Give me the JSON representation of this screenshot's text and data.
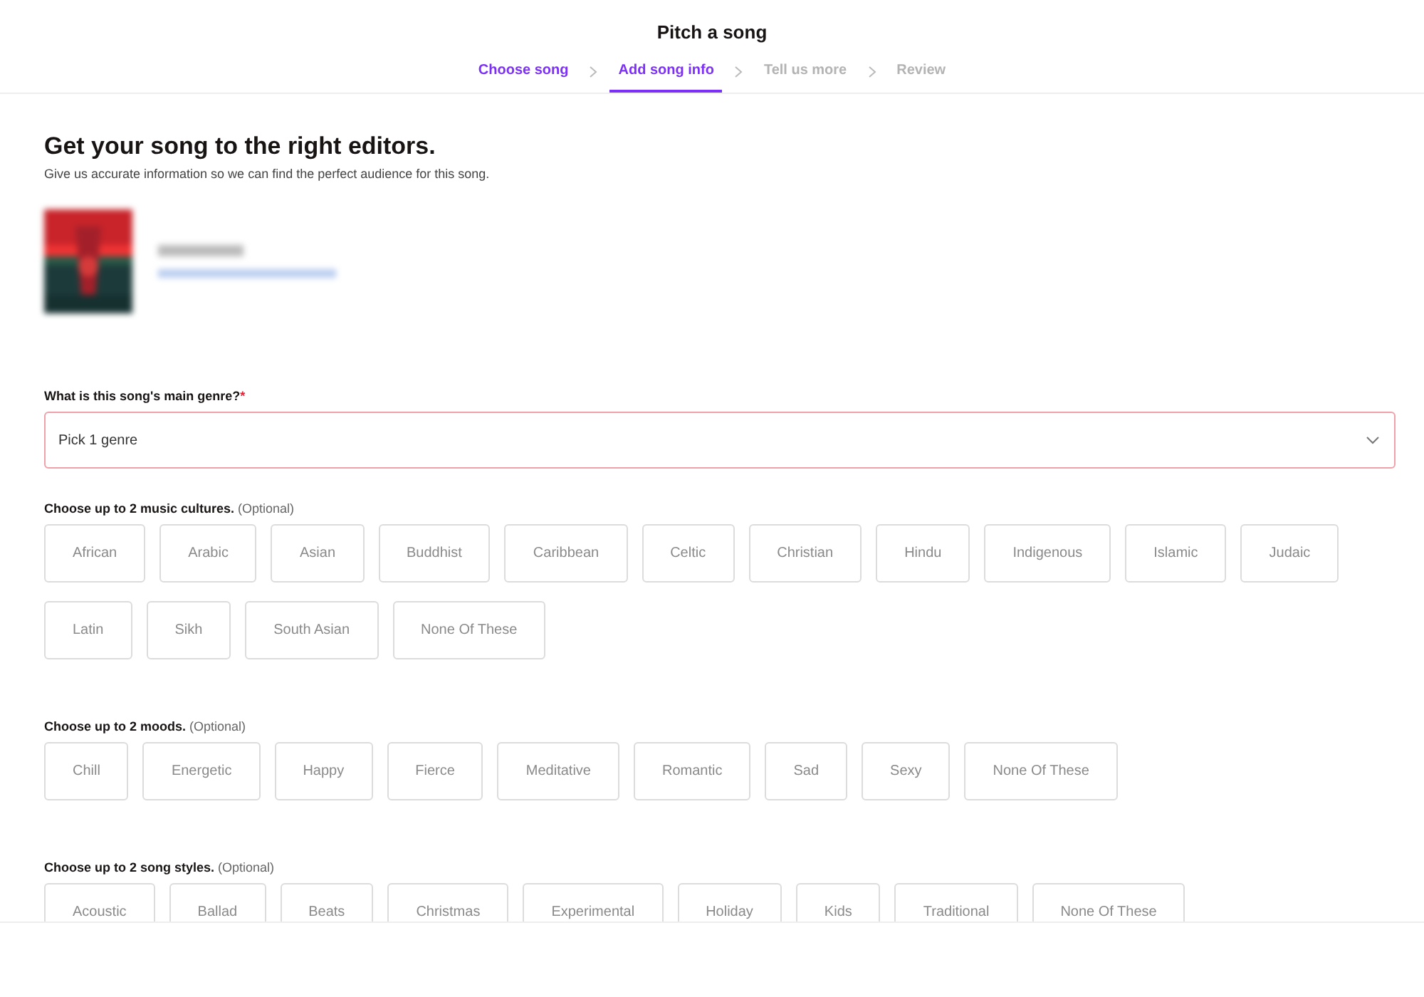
{
  "header": {
    "title": "Pitch a song",
    "steps": [
      {
        "label": "Choose song",
        "selected": false,
        "completed": true
      },
      {
        "label": "Add song info",
        "selected": true,
        "completed": false
      },
      {
        "label": "Tell us more",
        "selected": false,
        "completed": false
      },
      {
        "label": "Review",
        "selected": false,
        "completed": false
      }
    ]
  },
  "intro": {
    "heading": "Get your song to the right editors.",
    "subtitle": "Give us accurate information so we can find the perfect audience for this song."
  },
  "genre": {
    "label": "What is this song's main genre?",
    "required_mark": "*",
    "placeholder": "Pick 1 genre",
    "error": true
  },
  "groups": [
    {
      "label": "Choose up to 2 music cultures.",
      "hint": "(Optional)",
      "options": [
        {
          "label": "African",
          "selected": false
        },
        {
          "label": "Arabic",
          "selected": false
        },
        {
          "label": "Asian",
          "selected": false
        },
        {
          "label": "Buddhist",
          "selected": false
        },
        {
          "label": "Caribbean",
          "selected": false
        },
        {
          "label": "Celtic",
          "selected": false
        },
        {
          "label": "Christian",
          "selected": false
        },
        {
          "label": "Hindu",
          "selected": false
        },
        {
          "label": "Indigenous",
          "selected": false
        },
        {
          "label": "Islamic",
          "selected": false
        },
        {
          "label": "Judaic",
          "selected": false
        },
        {
          "label": "Latin",
          "selected": false
        },
        {
          "label": "Sikh",
          "selected": false
        },
        {
          "label": "South Asian",
          "selected": false
        },
        {
          "label": "None Of These",
          "selected": false
        }
      ]
    },
    {
      "label": "Choose up to 2 moods.",
      "hint": "(Optional)",
      "options": [
        {
          "label": "Chill",
          "selected": false
        },
        {
          "label": "Energetic",
          "selected": false
        },
        {
          "label": "Happy",
          "selected": false
        },
        {
          "label": "Fierce",
          "selected": false
        },
        {
          "label": "Meditative",
          "selected": false
        },
        {
          "label": "Romantic",
          "selected": false
        },
        {
          "label": "Sad",
          "selected": false
        },
        {
          "label": "Sexy",
          "selected": false
        },
        {
          "label": "None Of These",
          "selected": false
        }
      ]
    },
    {
      "label": "Choose up to 2 song styles.",
      "hint": "(Optional)",
      "options": [
        {
          "label": "Acoustic",
          "selected": false
        },
        {
          "label": "Ballad",
          "selected": false
        },
        {
          "label": "Beats",
          "selected": false
        },
        {
          "label": "Christmas",
          "selected": false
        },
        {
          "label": "Experimental",
          "selected": false
        },
        {
          "label": "Holiday",
          "selected": false
        },
        {
          "label": "Kids",
          "selected": false
        },
        {
          "label": "Traditional",
          "selected": false
        },
        {
          "label": "None Of These",
          "selected": false
        }
      ]
    }
  ]
}
